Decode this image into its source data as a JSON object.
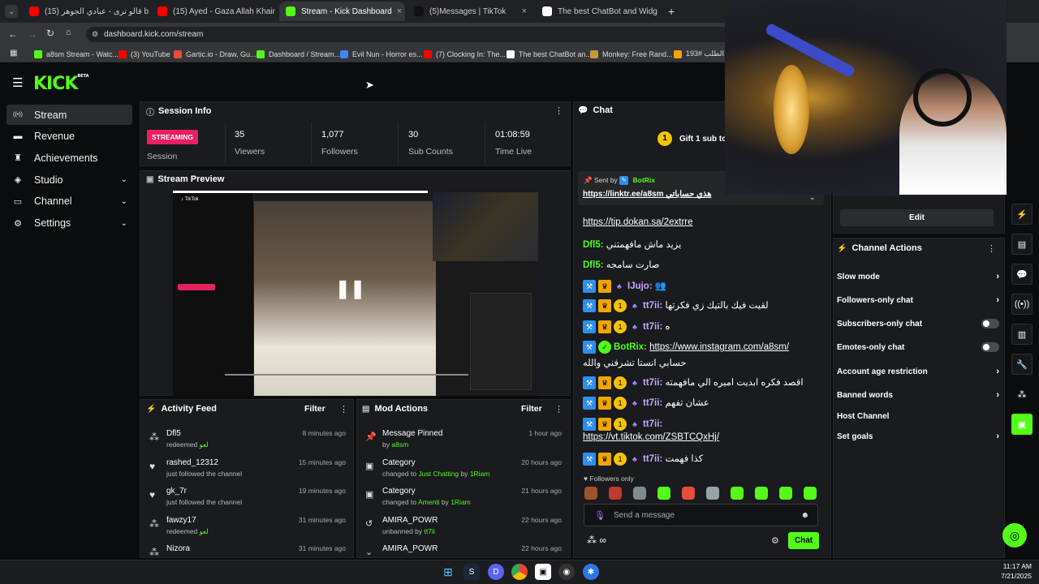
{
  "browser": {
    "tabs": [
      {
        "title": "(15) قالو ترى - عبادي الجوهر be",
        "color": "#ff0000"
      },
      {
        "title": "(15) Ayed - Gaza Allah Khair (T",
        "color": "#ff0000"
      },
      {
        "title": "Stream - Kick Dashboard",
        "color": "#53fc18"
      },
      {
        "title": "(5)Messages | TikTok",
        "color": "#111111"
      },
      {
        "title": "The best ChatBot and Widg",
        "color": "#ffffff"
      }
    ],
    "url": "dashboard.kick.com/stream",
    "bookmarks": [
      "a8sm Stream - Watc...",
      "(3) YouTube",
      "Gartic.io - Draw, Gu...",
      "Dashboard / Stream...",
      "Evil Nun - Horror es...",
      "(7) Clocking In: The...",
      "The best ChatBot an...",
      "Monkey: Free Rand...",
      "193# الطلب..."
    ]
  },
  "kick": {
    "logo": "KICK",
    "logo_tag": "BETA",
    "nav": [
      {
        "label": "Stream",
        "icon": "stream-icon",
        "active": true,
        "chevron": false
      },
      {
        "label": "Revenue",
        "icon": "revenue-icon",
        "active": false,
        "chevron": false
      },
      {
        "label": "Achievements",
        "icon": "trophy-icon",
        "active": false,
        "chevron": false
      },
      {
        "label": "Studio",
        "icon": "studio-icon",
        "active": false,
        "chevron": true
      },
      {
        "label": "Channel",
        "icon": "channel-icon",
        "active": false,
        "chevron": true
      },
      {
        "label": "Settings",
        "icon": "gear-icon",
        "active": false,
        "chevron": true
      }
    ]
  },
  "session": {
    "title": "Session Info",
    "status_badge": "STREAMING",
    "status_label": "Session",
    "stats": [
      {
        "value": "35",
        "label": "Viewers"
      },
      {
        "value": "1,077",
        "label": "Followers"
      },
      {
        "value": "30",
        "label": "Sub Counts"
      },
      {
        "value": "01:08:59",
        "label": "Time Live"
      }
    ]
  },
  "preview": {
    "title": "Stream Preview"
  },
  "activity": {
    "title": "Activity Feed",
    "filter": "Filter",
    "items": [
      {
        "name": "Dfl5",
        "sub": "redeemed",
        "extra": "لعو",
        "time": "8 minutes ago",
        "icon": "redeem-icon"
      },
      {
        "name": "rashed_12312",
        "sub": "just followed the channel",
        "extra": "",
        "time": "15 minutes ago",
        "icon": "heart-icon"
      },
      {
        "name": "gk_7r",
        "sub": "just followed the channel",
        "extra": "",
        "time": "19 minutes ago",
        "icon": "heart-icon"
      },
      {
        "name": "fawzy17",
        "sub": "redeemed",
        "extra": "لعو",
        "time": "31 minutes ago",
        "icon": "redeem-icon"
      },
      {
        "name": "Nizora",
        "sub": "",
        "extra": "",
        "time": "31 minutes ago",
        "icon": "redeem-icon"
      }
    ]
  },
  "mod": {
    "title": "Mod Actions",
    "filter": "Filter",
    "items": [
      {
        "name": "Message Pinned",
        "pre": "by",
        "a": "a8sm",
        "mid": "",
        "b": "",
        "time": "1 hour ago",
        "icon": "pin-icon"
      },
      {
        "name": "Category",
        "pre": "changed to",
        "a": "Just Chatting",
        "mid": "by",
        "b": "1Riam",
        "time": "20 hours ago",
        "icon": "category-icon"
      },
      {
        "name": "Category",
        "pre": "changed to",
        "a": "Amenti",
        "mid": "by",
        "b": "1Riam",
        "time": "21 hours ago",
        "icon": "category-icon"
      },
      {
        "name": "AMIRA_POWR",
        "pre": "unbanned by",
        "a": "tt7ii",
        "mid": "",
        "b": "",
        "time": "22 hours ago",
        "icon": "unban-icon"
      },
      {
        "name": "AMIRA_POWR",
        "pre": "",
        "a": "",
        "mid": "",
        "b": "",
        "time": "22 hours ago",
        "icon": "chevron-down-icon"
      }
    ]
  },
  "chat": {
    "title": "Chat",
    "gift_banner": "Gift 1 sub to ta",
    "gift_count": "1",
    "pinned_sender_label": "Sent by",
    "pinned_sender": "BotRix",
    "pinned_text": "https://linktr.ee/a8sm هذي حساباتي",
    "messages": [
      {
        "user": "",
        "text": "https://tip.dokan.sa/2extrre",
        "link": true,
        "badges": []
      },
      {
        "user": "Dfl5:",
        "text": "يزيد ماش مافهمتني",
        "link": false,
        "badges": []
      },
      {
        "user": "Dfl5:",
        "text": "صارت سامجه",
        "link": false,
        "badges": []
      },
      {
        "user": "IJujo:",
        "text": "",
        "link": false,
        "badges": [
          "mod",
          "crown",
          "gift"
        ]
      },
      {
        "user": "tt7ii:",
        "text": "لقيت فيك بالتيك زي فكرتها",
        "link": false,
        "badges": [
          "mod",
          "crown",
          "sub",
          "gift"
        ]
      },
      {
        "user": "tt7ii:",
        "text": "ه",
        "link": false,
        "badges": [
          "mod",
          "crown",
          "sub",
          "gift"
        ]
      },
      {
        "user": "BotRix:",
        "text": "https://www.instagram.com/a8sm/",
        "link": true,
        "badges": [
          "mod",
          "verified"
        ]
      },
      {
        "user": "",
        "text": "حسابي انستا تشرفني والله",
        "link": false,
        "badges": []
      },
      {
        "user": "tt7ii:",
        "text": "اقصد فكره ابديت اميره الي مافهمته",
        "link": false,
        "badges": [
          "mod",
          "crown",
          "sub",
          "gift"
        ]
      },
      {
        "user": "tt7ii:",
        "text": "عشان تفهم",
        "link": false,
        "badges": [
          "mod",
          "crown",
          "sub",
          "gift"
        ]
      },
      {
        "user": "tt7ii:",
        "text": "",
        "link": false,
        "badges": [
          "mod",
          "crown",
          "sub",
          "gift"
        ]
      },
      {
        "user": "",
        "text": "https://vt.tiktok.com/ZSBTCQxHj/",
        "link": true,
        "badges": []
      },
      {
        "user": "tt7ii:",
        "text": "كذا فهمت",
        "link": false,
        "badges": [
          "mod",
          "crown",
          "sub",
          "gift"
        ]
      }
    ],
    "followers_only": "Followers only",
    "placeholder": "Send a message",
    "send_label": "Chat"
  },
  "channel": {
    "edit": "Edit",
    "actions_title": "Channel Actions",
    "actions": [
      {
        "label": "Slow mode",
        "type": "arrow"
      },
      {
        "label": "Followers-only chat",
        "type": "arrow"
      },
      {
        "label": "Subscribers-only chat",
        "type": "toggle"
      },
      {
        "label": "Emotes-only chat",
        "type": "toggle"
      },
      {
        "label": "Account age restriction",
        "type": "arrow"
      },
      {
        "label": "Banned words",
        "type": "arrow"
      },
      {
        "label": "Host Channel",
        "type": "none"
      },
      {
        "label": "Set goals",
        "type": "arrow"
      }
    ]
  },
  "taskbar": {
    "time": "11:17 AM",
    "date": "7/21/2025"
  },
  "colors": {
    "accent": "#53fc18",
    "streaming": "#e91e63",
    "mod": "#2d8ff0",
    "crown": "#f0a500"
  }
}
